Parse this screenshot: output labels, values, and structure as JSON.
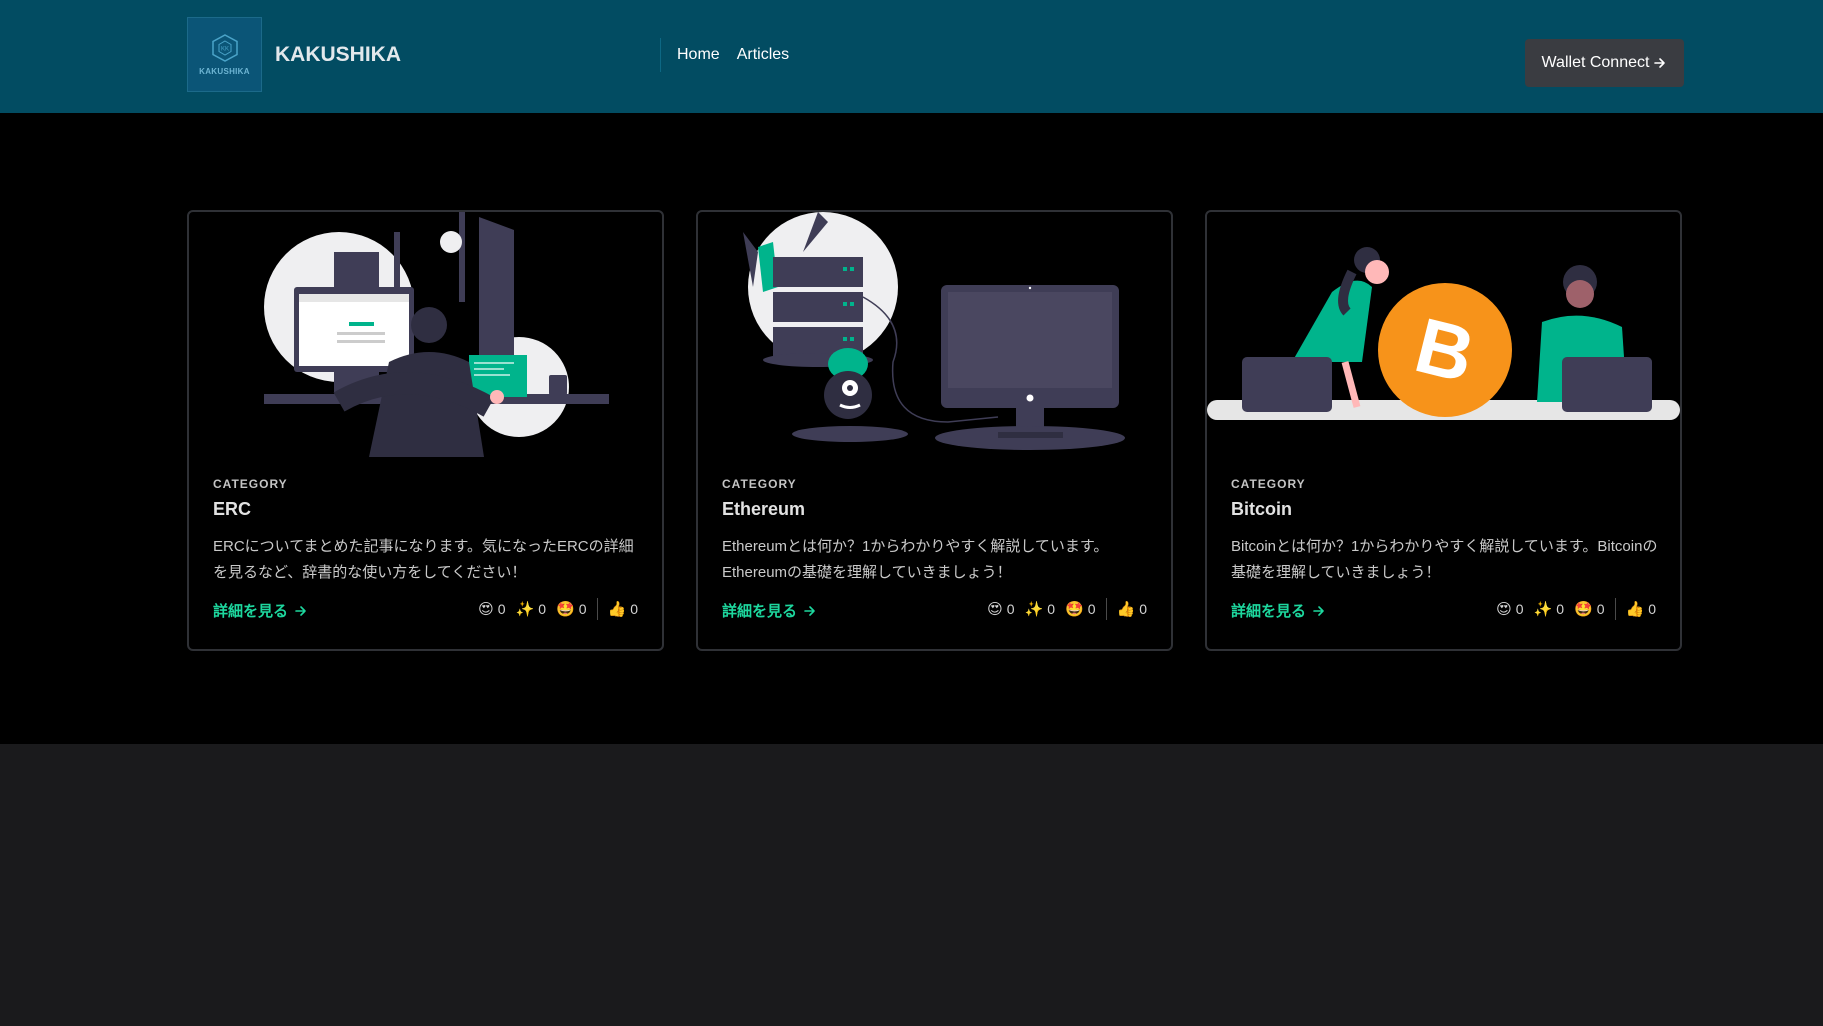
{
  "header": {
    "logo_text": "KAKUSHIKA",
    "brand": "KAKUSHIKA",
    "nav": [
      "Home",
      "Articles"
    ],
    "wallet_label": "Wallet Connect",
    "wallet_icon": "arrow-right-icon"
  },
  "colors": {
    "header_bg": "#024c62",
    "accent": "#1dd79e",
    "bitcoin": "#f7931a",
    "teal": "#00b48c"
  },
  "cards": [
    {
      "category_label": "CATEGORY",
      "category": "ERC",
      "description": "ERCについてまとめた記事になります。気になったERCの詳細を見るなど、辞書的な使い方をしてください！",
      "link": "詳細を見る",
      "reactions": [
        {
          "icon": "😍",
          "count": "0"
        },
        {
          "icon": "✨",
          "count": "0"
        },
        {
          "icon": "🤩",
          "count": "0"
        },
        {
          "icon": "👍",
          "count": "0"
        }
      ]
    },
    {
      "category_label": "CATEGORY",
      "category": "Ethereum",
      "description": "Ethereumとは何か？1からわかりやすく解説しています。Ethereumの基礎を理解していきましょう！",
      "link": "詳細を見る",
      "reactions": [
        {
          "icon": "😍",
          "count": "0"
        },
        {
          "icon": "✨",
          "count": "0"
        },
        {
          "icon": "🤩",
          "count": "0"
        },
        {
          "icon": "👍",
          "count": "0"
        }
      ]
    },
    {
      "category_label": "CATEGORY",
      "category": "Bitcoin",
      "description": "Bitcoinとは何か？1からわかりやすく解説しています。Bitcoinの基礎を理解していきましょう！",
      "link": "詳細を見る",
      "reactions": [
        {
          "icon": "😍",
          "count": "0"
        },
        {
          "icon": "✨",
          "count": "0"
        },
        {
          "icon": "🤩",
          "count": "0"
        },
        {
          "icon": "👍",
          "count": "0"
        }
      ]
    }
  ]
}
